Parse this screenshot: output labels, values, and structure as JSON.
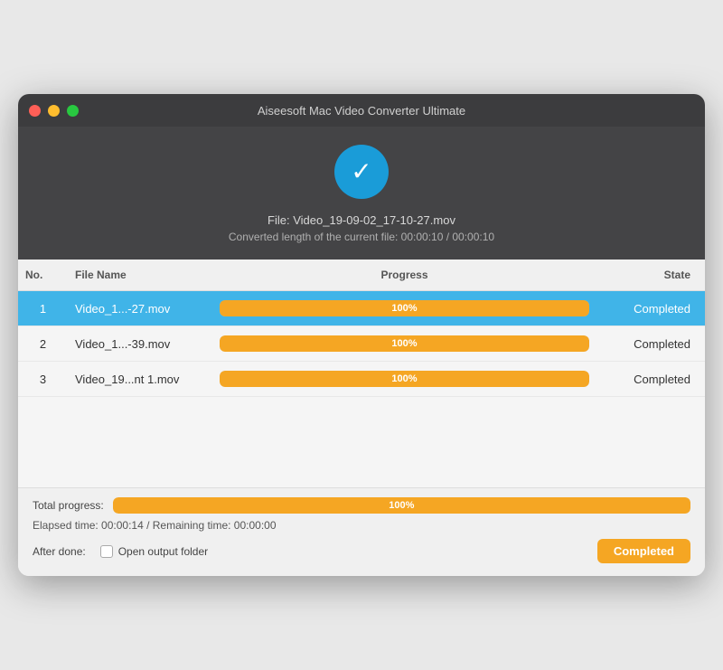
{
  "window": {
    "title": "Aiseesoft Mac Video Converter Ultimate"
  },
  "titlebar": {
    "close_label": "",
    "min_label": "",
    "max_label": ""
  },
  "header": {
    "file_label": "File: Video_19-09-02_17-10-27.mov",
    "length_label": "Converted length of the current file: 00:00:10 / 00:00:10"
  },
  "table": {
    "columns": [
      "No.",
      "File Name",
      "Progress",
      "State"
    ],
    "rows": [
      {
        "no": "1",
        "filename": "Video_1...-27.mov",
        "progress": 100,
        "progress_label": "100%",
        "state": "Completed",
        "selected": true
      },
      {
        "no": "2",
        "filename": "Video_1...-39.mov",
        "progress": 100,
        "progress_label": "100%",
        "state": "Completed",
        "selected": false
      },
      {
        "no": "3",
        "filename": "Video_19...nt 1.mov",
        "progress": 100,
        "progress_label": "100%",
        "state": "Completed",
        "selected": false
      }
    ]
  },
  "footer": {
    "total_progress_label": "Total progress:",
    "total_progress_value": 100,
    "total_progress_text": "100%",
    "elapsed_label": "Elapsed time: 00:00:14 / Remaining time: 00:00:00",
    "after_done_label": "After done:",
    "open_output_label": "Open output folder",
    "completed_button_label": "Completed"
  }
}
